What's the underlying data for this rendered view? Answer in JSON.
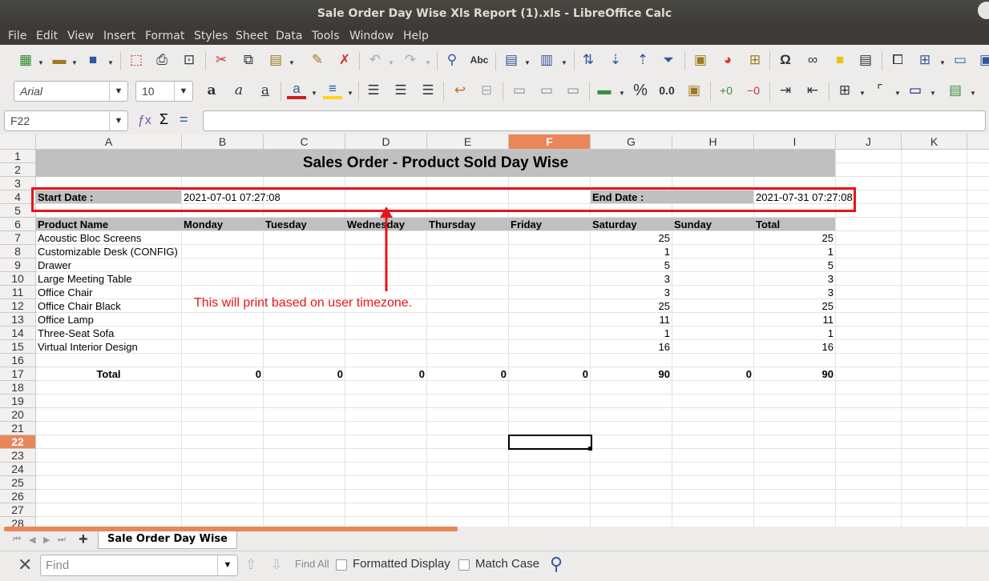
{
  "window": {
    "title": "Sale Order Day Wise Xls Report (1).xls - LibreOffice Calc"
  },
  "menu": [
    "File",
    "Edit",
    "View",
    "Insert",
    "Format",
    "Styles",
    "Sheet",
    "Data",
    "Tools",
    "Window",
    "Help"
  ],
  "format": {
    "font_name": "Arial",
    "font_size": "10"
  },
  "formula": {
    "name_box": "F22",
    "content": ""
  },
  "columns": [
    "A",
    "B",
    "C",
    "D",
    "E",
    "F",
    "G",
    "H",
    "I",
    "J",
    "K"
  ],
  "active_column": "F",
  "rows": [
    "1",
    "2",
    "3",
    "4",
    "5",
    "6",
    "7",
    "8",
    "9",
    "10",
    "11",
    "12",
    "13",
    "14",
    "15",
    "16",
    "17",
    "18",
    "19",
    "20",
    "21",
    "22",
    "23",
    "24",
    "25",
    "26",
    "27",
    "28"
  ],
  "active_row": "22",
  "report": {
    "title": "Sales Order - Product Sold Day Wise",
    "start_label": "Start Date :",
    "start_value": "2021-07-01 07:27:08",
    "end_label": "End Date :",
    "end_value": "2021-07-31 07:27:08",
    "headers": [
      "Product Name",
      "Monday",
      "Tuesday",
      "Wednesday",
      "Thursday",
      "Friday",
      "Saturday",
      "Sunday",
      "Total"
    ],
    "products": [
      {
        "name": "Acoustic Bloc Screens",
        "saturday": "25",
        "total": "25"
      },
      {
        "name": "Customizable Desk (CONFIG)",
        "saturday": "1",
        "total": "1"
      },
      {
        "name": "Drawer",
        "saturday": "5",
        "total": "5"
      },
      {
        "name": "Large Meeting Table",
        "saturday": "3",
        "total": "3"
      },
      {
        "name": "Office Chair",
        "saturday": "3",
        "total": "3"
      },
      {
        "name": "Office Chair Black",
        "saturday": "25",
        "total": "25"
      },
      {
        "name": "Office Lamp",
        "saturday": "11",
        "total": "11"
      },
      {
        "name": "Three-Seat Sofa",
        "saturday": "1",
        "total": "1"
      },
      {
        "name": "Virtual Interior Design",
        "saturday": "16",
        "total": "16"
      }
    ],
    "total_label": "Total",
    "totals": [
      "0",
      "0",
      "0",
      "0",
      "0",
      "90",
      "0",
      "90"
    ]
  },
  "annotation": {
    "text": "This will print based on user timezone.",
    "color": "#e8141a"
  },
  "sheet_tab": "Sale Order Day Wise",
  "findbar": {
    "placeholder": "Find",
    "find_all": "Find All",
    "formatted_display": "Formatted Display",
    "match_case": "Match Case"
  }
}
